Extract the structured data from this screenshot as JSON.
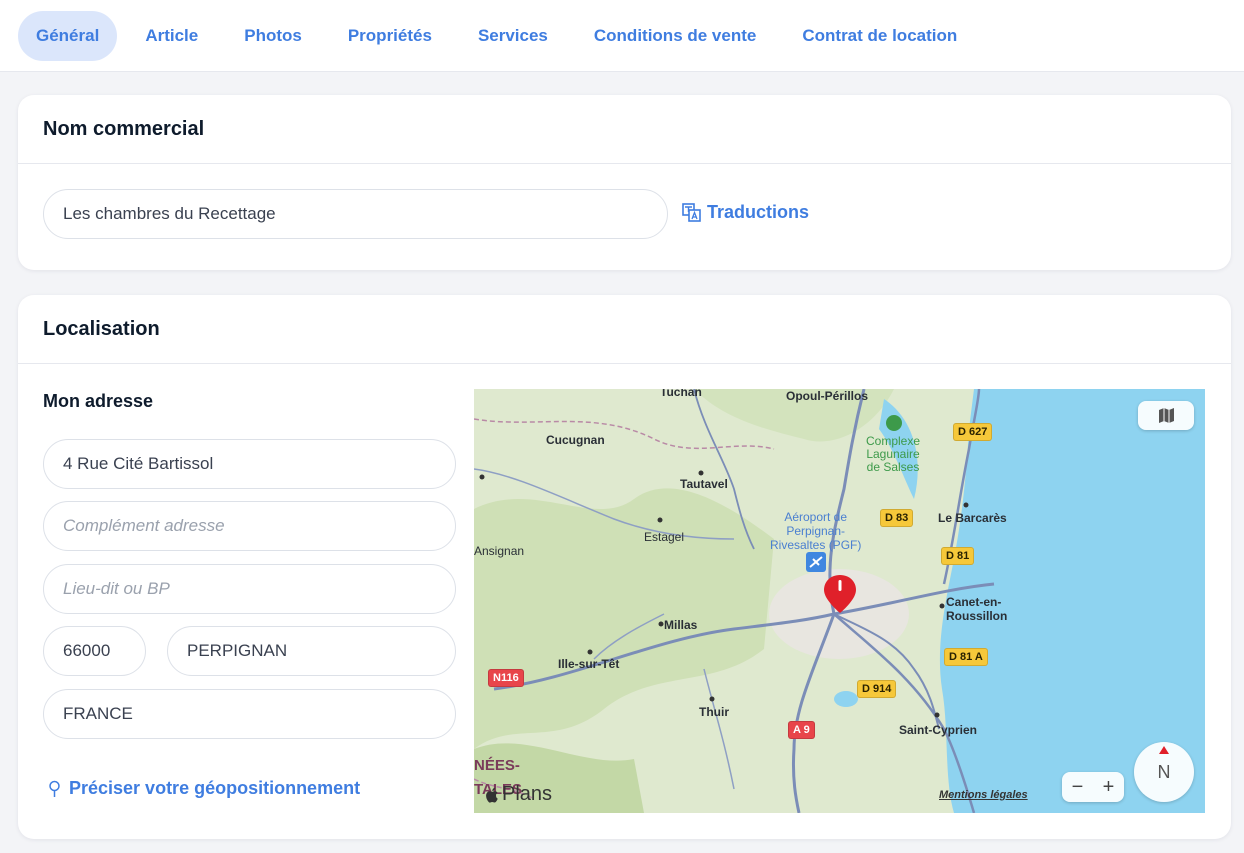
{
  "tabs": [
    {
      "label": "Général",
      "active": true
    },
    {
      "label": "Article"
    },
    {
      "label": "Photos"
    },
    {
      "label": "Propriétés"
    },
    {
      "label": "Services"
    },
    {
      "label": "Conditions de vente"
    },
    {
      "label": "Contrat de location"
    }
  ],
  "commercial": {
    "title": "Nom commercial",
    "name_value": "Les chambres du Recettage",
    "translations_label": "Traductions"
  },
  "location": {
    "title": "Localisation",
    "address_heading": "Mon adresse",
    "street_value": "4 Rue Cité Bartissol",
    "complement_placeholder": "Complément adresse",
    "lieudit_placeholder": "Lieu-dit ou BP",
    "postal_code": "66000",
    "city": "PERPIGNAN",
    "country": "FRANCE",
    "geo_link": "Préciser votre géopositionnement"
  },
  "map": {
    "labels": {
      "tuchan": "Tuchan",
      "opoul": "Opoul-Périllos",
      "cucugnan": "Cucugnan",
      "tautavel": "Tautavel",
      "estagel": "Estagel",
      "ansignan": "Ansignan",
      "millas": "Millas",
      "ille": "Ille-sur-Têt",
      "thuir": "Thuir",
      "saint_cyprien": "Saint-Cyprien",
      "le_barcares": "Le Barcarès",
      "canet": "Canet-en-\nRoussillon",
      "airport": "Aéroport de\nPerpignan-\nRivesaltes (PGF)",
      "lagunaire": "Complexe\nLagunaire\nde Salses",
      "pyrenees": "NÉES-\nTALES"
    },
    "roads": {
      "d627": "D 627",
      "d83": "D 83",
      "d81": "D 81",
      "d81a": "D 81 A",
      "d914": "D 914",
      "n116": "N116",
      "a9": "A 9"
    },
    "brand": "Plans",
    "legal": "Mentions légales",
    "compass_letter": "N",
    "zoom_out": "−",
    "zoom_in": "+",
    "colors": {
      "sea": "#8ed3f0",
      "land": "#dfe9cf",
      "forest": "#c9dcb0",
      "road": "#7b8db7",
      "pin": "#e0202a"
    }
  }
}
